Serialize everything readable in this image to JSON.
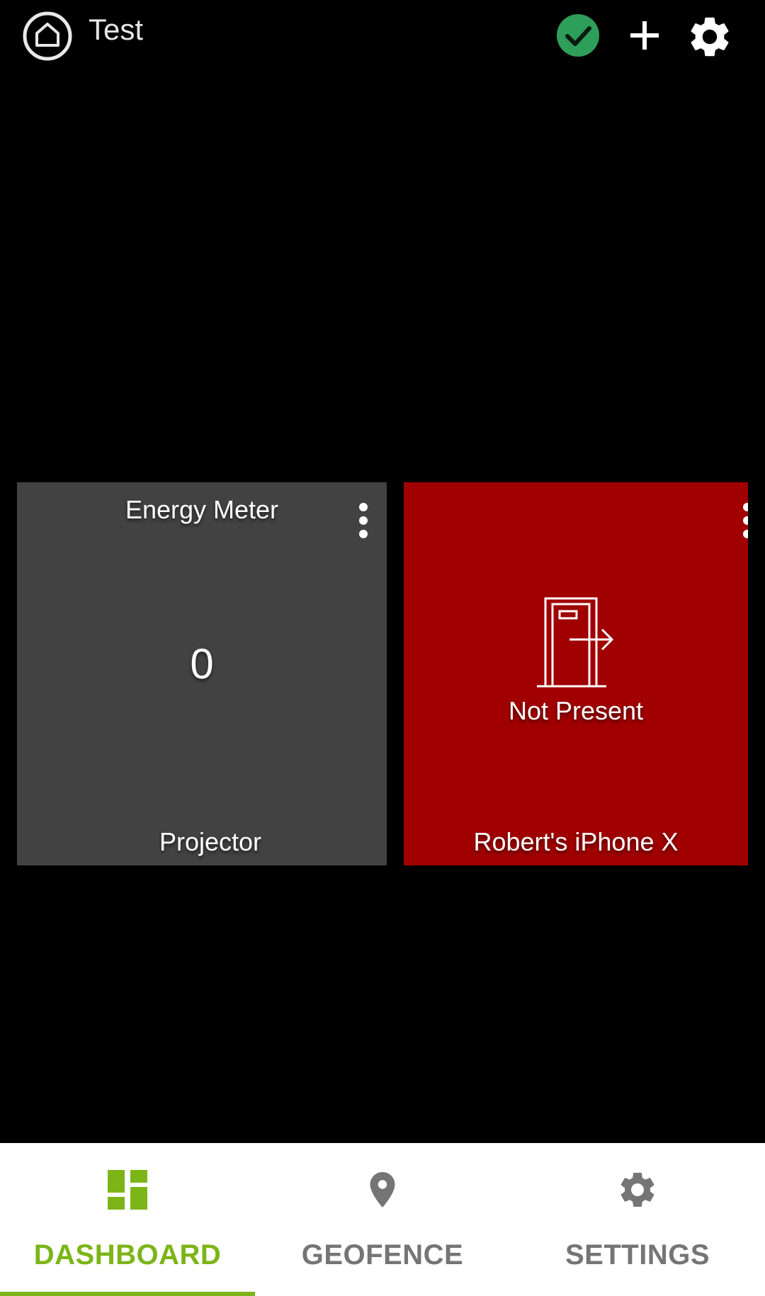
{
  "header": {
    "title": "Test",
    "logo_icon": "home-logo-icon",
    "status_icon": "check-circle-icon",
    "add_icon": "plus-icon",
    "settings_icon": "gear-icon"
  },
  "tiles": [
    {
      "title": "Energy Meter",
      "value": "0",
      "label": "Projector",
      "background": "#424242",
      "menu_icon": "more-vertical-icon"
    },
    {
      "state": "Not Present",
      "label": "Robert's iPhone X",
      "background": "#a00000",
      "state_icon": "door-exit-icon",
      "menu_icon": "more-vertical-icon"
    }
  ],
  "bottom_nav": {
    "tabs": [
      {
        "label": "DASHBOARD",
        "icon": "dashboard-icon",
        "active": true
      },
      {
        "label": "GEOFENCE",
        "icon": "location-pin-icon",
        "active": false
      },
      {
        "label": "SETTINGS",
        "icon": "gear-icon",
        "active": false
      }
    ]
  },
  "colors": {
    "accent": "#7cb518",
    "status_ok": "#2e9e5b",
    "inactive": "#757575"
  }
}
